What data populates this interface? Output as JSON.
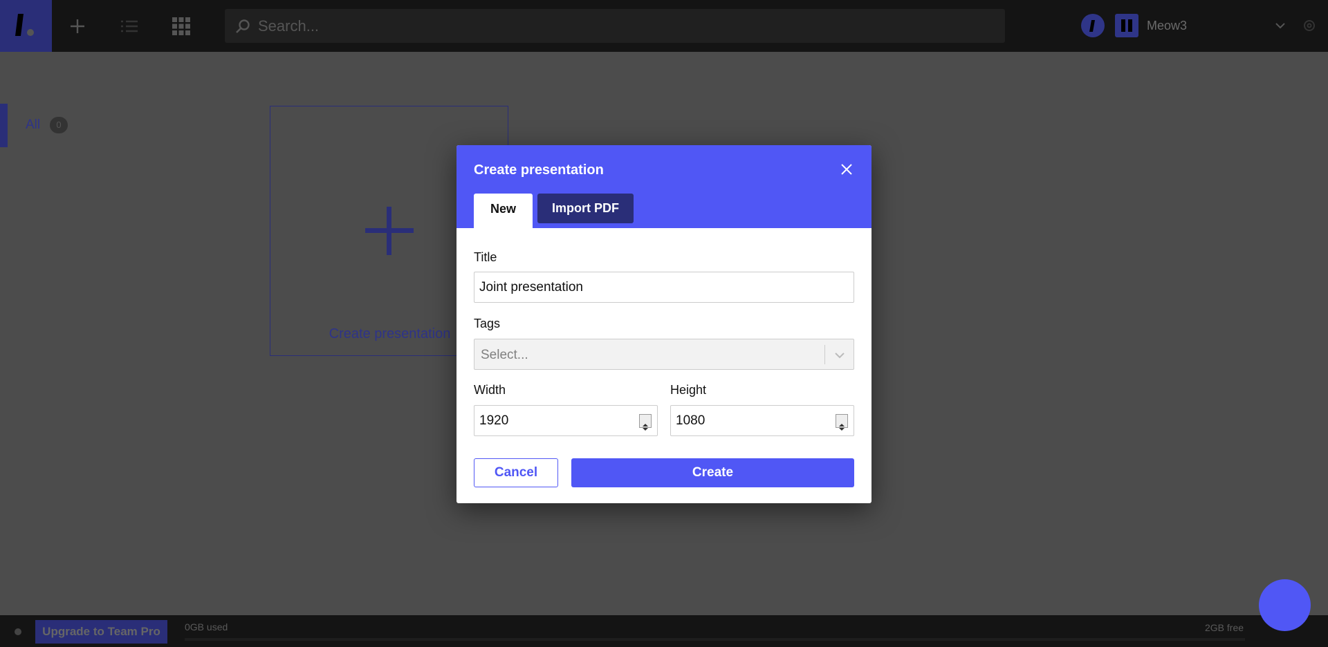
{
  "topbar": {
    "search_placeholder": "Search...",
    "workspace_name": "Meow3"
  },
  "sidebar": {
    "items": [
      {
        "label": "All",
        "count": "0"
      }
    ]
  },
  "main": {
    "create_card_label": "Create presentation"
  },
  "modal": {
    "title": "Create presentation",
    "tabs": [
      {
        "label": "New",
        "active": true
      },
      {
        "label": "Import PDF",
        "active": false
      }
    ],
    "title_field": {
      "label": "Title",
      "value": "Joint presentation"
    },
    "tags_field": {
      "label": "Tags",
      "placeholder": "Select..."
    },
    "width_field": {
      "label": "Width",
      "value": "1920"
    },
    "height_field": {
      "label": "Height",
      "value": "1080"
    },
    "cancel_label": "Cancel",
    "create_label": "Create"
  },
  "bottombar": {
    "upgrade_label": "Upgrade to Team Pro",
    "used_label": "0GB used",
    "free_label": "2GB free"
  },
  "colors": {
    "accent": "#5057f5",
    "accent_dark": "#2a2e78",
    "overlay_bg": "#4c4c4c"
  }
}
